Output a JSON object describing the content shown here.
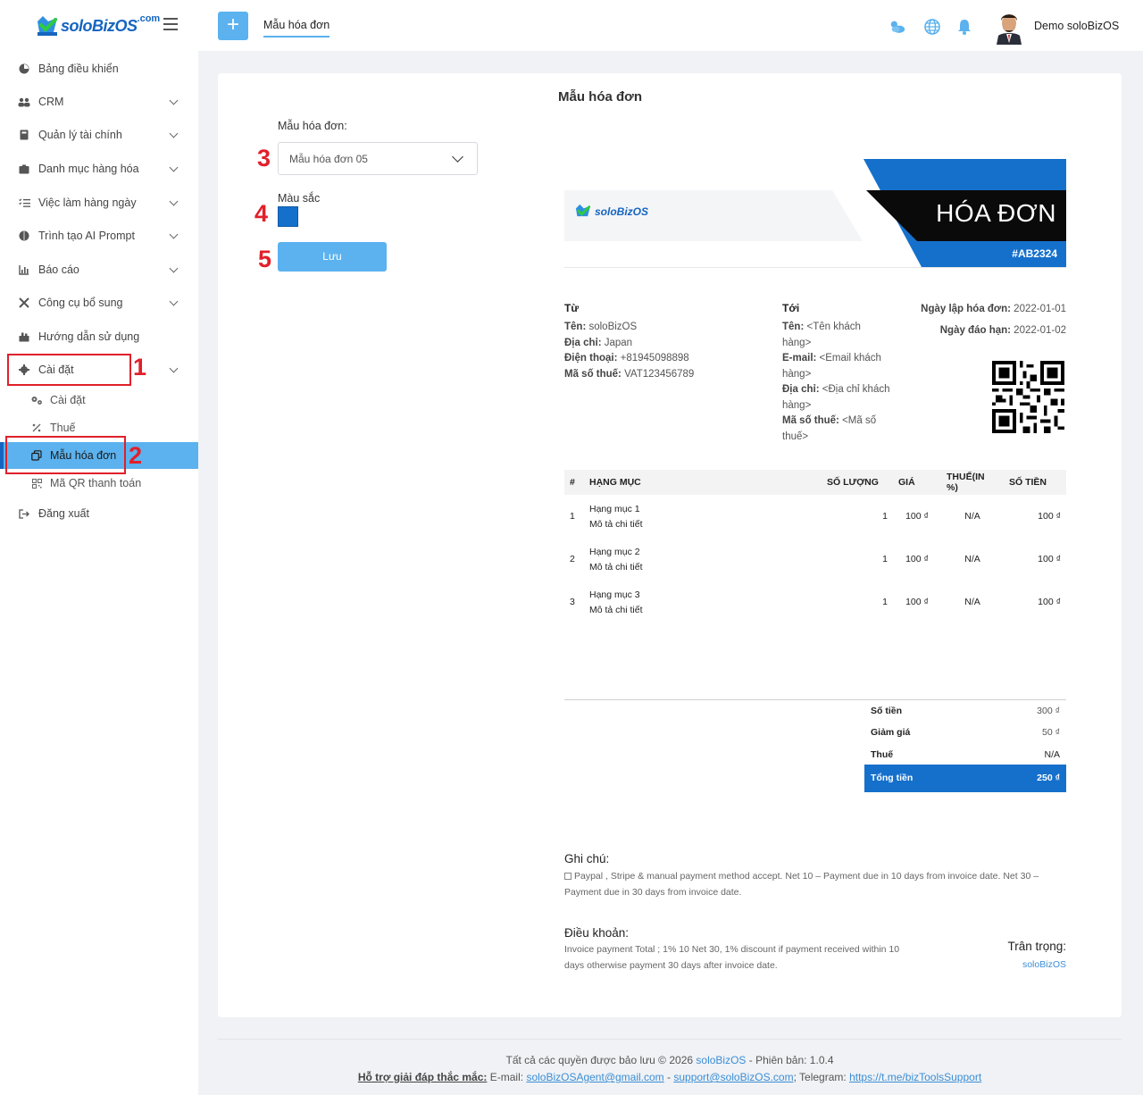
{
  "brand": {
    "logo_text": "soloBizOS",
    "logo_suffix": ".com",
    "accent": "#5bb2ee",
    "primary": "#1570cc"
  },
  "header": {
    "breadcrumb": "Mẫu hóa đơn",
    "icons": [
      "weather-icon",
      "globe-icon",
      "bell-icon"
    ],
    "user_name": "Demo soloBizOS"
  },
  "sidebar": {
    "items": [
      {
        "label": "Bảng điều khiển",
        "icon": "dashboard-icon"
      },
      {
        "label": "CRM",
        "icon": "users-icon"
      },
      {
        "label": "Quản lý tài chính",
        "icon": "finance-icon"
      },
      {
        "label": "Danh mục hàng hóa",
        "icon": "box-icon"
      },
      {
        "label": "Việc làm hàng ngày",
        "icon": "tasks-icon"
      },
      {
        "label": "Trình tạo AI Prompt",
        "icon": "brain-icon"
      },
      {
        "label": "Báo cáo",
        "icon": "chart-icon"
      },
      {
        "label": "Công cụ bổ sung",
        "icon": "tools-icon"
      },
      {
        "label": "Hướng dẫn sử dụng",
        "icon": "guide-icon"
      },
      {
        "label": "Cài đặt",
        "icon": "gear-icon"
      }
    ],
    "subitems": [
      {
        "label": "Cài đặt",
        "icon": "gears-icon"
      },
      {
        "label": "Thuế",
        "icon": "percent-icon"
      },
      {
        "label": "Mẫu hóa đơn",
        "icon": "copy-icon"
      },
      {
        "label": "Mã QR thanh toán",
        "icon": "qr-icon"
      }
    ],
    "logout": "Đăng xuất"
  },
  "markers": [
    "1",
    "2",
    "3",
    "4",
    "5"
  ],
  "page": {
    "title": "Mẫu hóa đơn",
    "template_label": "Mẫu hóa đơn:",
    "template_value": "Mẫu hóa đơn 05",
    "color_label": "Màu sắc",
    "color_value": "#1570cc",
    "save_label": "Lưu"
  },
  "invoice": {
    "title": "HÓA ĐƠN",
    "number": "#AB2324",
    "from_heading": "Từ",
    "from": [
      {
        "k": "Tên:",
        "v": "soloBizOS"
      },
      {
        "k": "Địa chỉ:",
        "v": "Japan"
      },
      {
        "k": "Điện thoại:",
        "v": "+81945098898"
      },
      {
        "k": "Mã số thuế:",
        "v": "VAT123456789"
      }
    ],
    "to_heading": "Tới",
    "to": {
      "name_k": "Tên:",
      "name_v": "<Tên khách",
      "name_v2": "hàng>",
      "email_k": "E-mail:",
      "email_v": "<Email khách",
      "email_v2": "hàng>",
      "addr_k": "Địa chỉ:",
      "addr_v": "<Địa chỉ khách",
      "addr_v2": "hàng>",
      "tax_k": "Mã số thuế:",
      "tax_v": "<Mã số",
      "tax_v2": "thuế>"
    },
    "date_issue_k": "Ngày lập hóa đơn:",
    "date_issue_v": "2022-01-01",
    "date_due_k": "Ngày đáo hạn:",
    "date_due_v": "2022-01-02",
    "columns": [
      "#",
      "HẠNG MỤC",
      "SỐ LƯỢNG",
      "GIÁ",
      "THUẾ(IN %)",
      "SỐ TIỀN"
    ],
    "rows": [
      {
        "no": "1",
        "name": "Hạng mục 1",
        "desc": "Mô tả chi tiết",
        "qty": "1",
        "price": "100 ₫",
        "tax": "N/A",
        "amount": "100 ₫"
      },
      {
        "no": "2",
        "name": "Hạng mục 2",
        "desc": "Mô tả chi tiết",
        "qty": "1",
        "price": "100 ₫",
        "tax": "N/A",
        "amount": "100 ₫"
      },
      {
        "no": "3",
        "name": "Hạng mục 3",
        "desc": "Mô tả chi tiết",
        "qty": "1",
        "price": "100 ₫",
        "tax": "N/A",
        "amount": "100 ₫"
      }
    ],
    "totals": {
      "subtotal_k": "Số tiền",
      "subtotal_v": "300 ₫",
      "discount_k": "Giảm giá",
      "discount_v": "50 ₫",
      "tax_k": "Thuế",
      "tax_v": "N/A",
      "total_k": "Tổng tiền",
      "total_v": "250 ₫"
    },
    "notes_heading": "Ghi chú:",
    "notes_line1": "Paypal , Stripe & manual payment method accept. Net 10 – Payment due in 10 days from invoice date. Net 30 –",
    "notes_line2": "Payment due in 30 days from invoice date.",
    "terms_heading": "Điều khoản:",
    "terms_line1": "Invoice payment Total ; 1% 10 Net 30, 1% discount if payment received within 10",
    "terms_line2": "days otherwise payment 30 days after invoice date.",
    "regards": "Trân trọng:",
    "signature": "soloBizOS"
  },
  "footer": {
    "copyright_prefix": "Tất cả các quyền được bảo lưu © 2026",
    "copyright_brand": "soloBizOS",
    "version": "- Phiên bản: 1.0.4",
    "support_label": "Hỗ trợ giải đáp thắc mắc:",
    "email_label": "E-mail:",
    "email1": "soloBizOSAgent@gmail.com",
    "email2": "support@soloBizOS.com",
    "telegram_label": "; Telegram:",
    "telegram": "https://t.me/bizToolsSupport"
  }
}
